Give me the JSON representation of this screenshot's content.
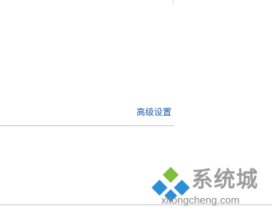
{
  "panel": {
    "advanced_settings_link": "高级设置"
  },
  "watermark": {
    "title": "系统城",
    "url": "xitongcheng.com",
    "logo_icon": "diamond-logo-icon",
    "colors": {
      "green": "#7dbe3c",
      "blue": "#2b8fd6",
      "gray": "#9b9b9b"
    }
  }
}
